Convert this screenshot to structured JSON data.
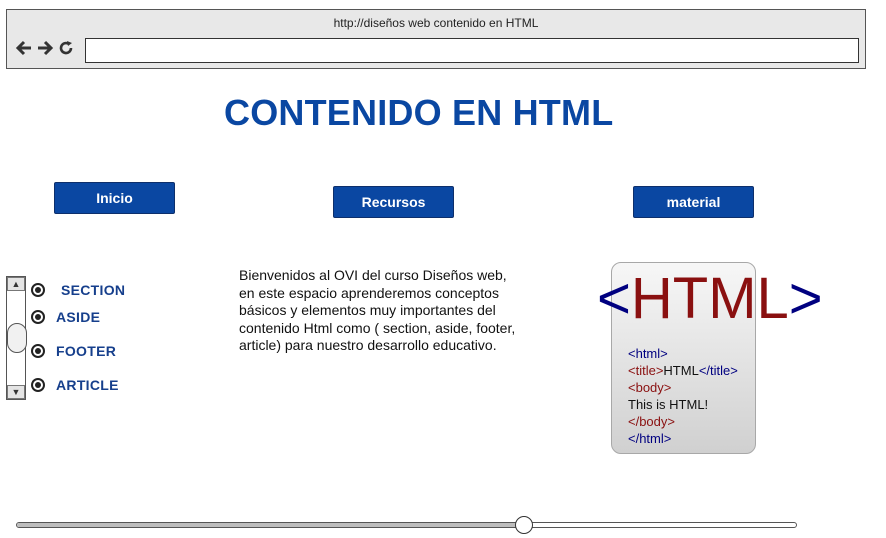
{
  "browser": {
    "title": "http://diseños web contenido en HTML",
    "address_value": "",
    "icons": [
      "back-arrow-icon",
      "forward-arrow-icon",
      "reload-icon"
    ]
  },
  "page": {
    "heading": "CONTENIDO EN HTML",
    "accent_color": "#0a47a2"
  },
  "nav": {
    "inicio": "Inicio",
    "recursos": "Recursos",
    "material": "material"
  },
  "sections": {
    "items": [
      "SECTION",
      "ASIDE",
      "FOOTER",
      "ARTICLE"
    ]
  },
  "intro_text": "Bienvenidos al OVI del curso Diseños web, en este espacio aprenderemos conceptos básicos y elementos muy importantes del contenido Html como ( section, aside, footer, article) para nuestro desarrollo educativo.",
  "html_image": {
    "open_bracket": "<",
    "word": "HTML",
    "close_bracket": ">",
    "lines": {
      "l1_tag": "<html>",
      "l2_open": "<title>",
      "l2_text": "HTML",
      "l2_close": "</title>",
      "l3_tag": "<body>",
      "l4_text": "This is HTML!",
      "l5_tag": "</body>",
      "l6_tag": "</html>"
    }
  },
  "slider": {
    "value_fraction": 0.65
  }
}
